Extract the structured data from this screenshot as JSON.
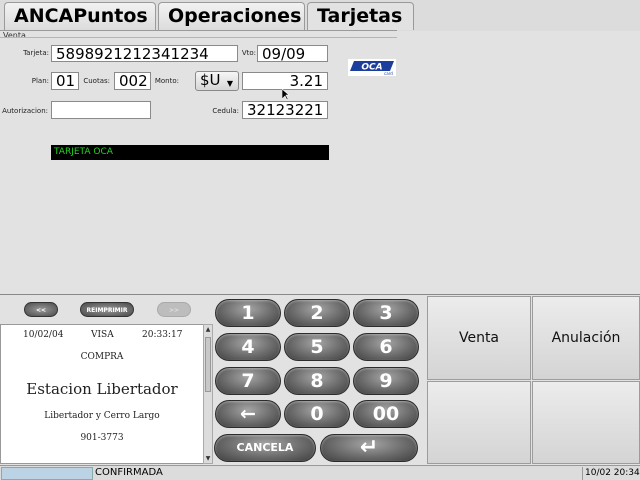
{
  "tabs": [
    {
      "label": "ANCAPuntos"
    },
    {
      "label": "Operaciones"
    },
    {
      "label": "Tarjetas"
    }
  ],
  "venta": {
    "group_title": "Venta",
    "tarjeta_label": "Tarjeta:",
    "tarjeta_value": "5898921212341234",
    "vto_label": "Vto:",
    "vto_value": "09/09",
    "plan_label": "Plan:",
    "plan_value": "01",
    "cuotas_label": "Cuotas:",
    "cuotas_value": "002",
    "monto_label": "Monto:",
    "currency_value": "$U",
    "monto_value": "3.21",
    "autorizacion_label": "Autorizacion:",
    "autorizacion_value": "",
    "cedula_label": "Cedula:",
    "cedula_value": "32123221",
    "card_status": "TARJETA OCA",
    "logo_text": "OCA",
    "logo_sub": "card"
  },
  "receipt_nav": {
    "prev": "<<",
    "reprint": "REIMPRIMIR",
    "next": ">>"
  },
  "receipt": {
    "date": "10/02/04",
    "card": "VISA",
    "time": "20:33:17",
    "type": "COMPRA",
    "station": "Estacion Libertador",
    "address": "Libertador y Cerro Largo",
    "phone": "901-3773"
  },
  "keypad": {
    "k1": "1",
    "k2": "2",
    "k3": "3",
    "k4": "4",
    "k5": "5",
    "k6": "6",
    "k7": "7",
    "k8": "8",
    "k9": "9",
    "back": "←",
    "k0": "0",
    "k00": "00",
    "cancel": "CANCELA",
    "enter": "↵"
  },
  "actions": {
    "venta": "Venta",
    "anulacion": "Anulación"
  },
  "statusbar": {
    "state": "CONFIRMADA",
    "datetime": "10/02 20:34"
  },
  "colors": {
    "status_text": "#21d621",
    "logo_blue": "#1c3f9e"
  }
}
